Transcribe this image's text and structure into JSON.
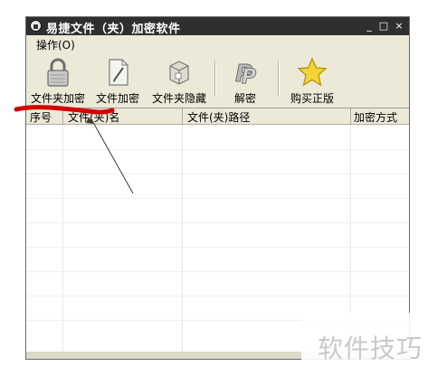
{
  "window": {
    "title": "易捷文件（夹）加密软件",
    "buttons": {
      "minimize": "_",
      "maximize": "□",
      "close": "×"
    }
  },
  "menu": {
    "items": [
      "操作(O)"
    ]
  },
  "toolbar": {
    "buttons": [
      {
        "label": "文件夹加密",
        "icon": "padlock-icon"
      },
      {
        "label": "文件加密",
        "icon": "document-pencil-icon"
      },
      {
        "label": "文件夹隐藏",
        "icon": "box-icon"
      },
      {
        "label": "解密",
        "icon": "p-key-icon"
      },
      {
        "label": "购买正版",
        "icon": "star-icon"
      }
    ]
  },
  "table": {
    "columns": [
      "序号",
      "文件(夹)名",
      "文件(夹)路径",
      "加密方式"
    ]
  },
  "watermark": {
    "text": "软件技巧"
  },
  "colors": {
    "titlebar": "#2f2f2f",
    "chrome": "#ece9d8",
    "annotation": "#d40000"
  }
}
